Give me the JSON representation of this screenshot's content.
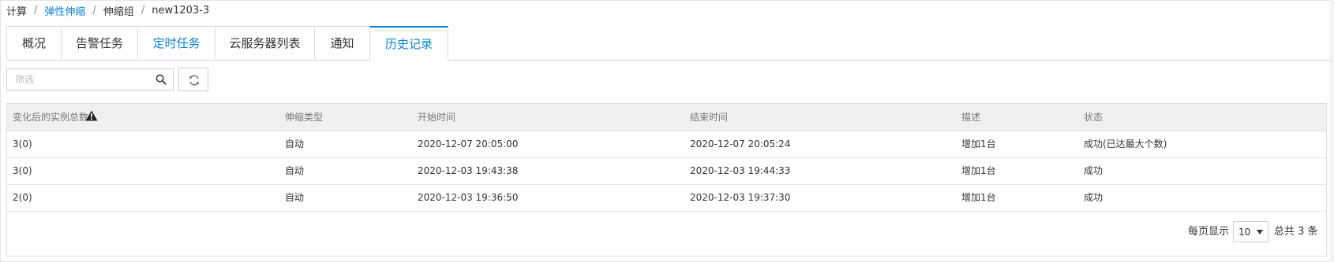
{
  "breadcrumb": [
    {
      "label": "计算"
    },
    {
      "label": "弹性伸缩"
    },
    {
      "label": "伸缩组"
    },
    {
      "label": "new1203-3"
    }
  ],
  "tabs": [
    {
      "label": "概况"
    },
    {
      "label": "告警任务"
    },
    {
      "label": "定时任务"
    },
    {
      "label": "云服务器列表"
    },
    {
      "label": "通知"
    },
    {
      "label": "历史记录"
    }
  ],
  "active_tab": "历史记录",
  "toolbar": {
    "search_placeholder": "筛选",
    "search_value": "",
    "search_icon": "search-icon",
    "refresh_icon": "refresh-icon"
  },
  "table": {
    "headers": [
      "变化后的实例总数",
      "伸缩类型",
      "开始时间",
      "结束时间",
      "描述",
      "状态"
    ],
    "header_icon": "warning-icon",
    "rows": [
      {
        "count": "3(0)",
        "type": "自动",
        "start": "2020-12-07 20:05:00",
        "end": "2020-12-07 20:05:24",
        "desc": "增加1台",
        "status": "成功(已达最大个数)"
      },
      {
        "count": "3(0)",
        "type": "自动",
        "start": "2020-12-03 19:43:38",
        "end": "2020-12-03 19:44:33",
        "desc": "增加1台",
        "status": "成功"
      },
      {
        "count": "2(0)",
        "type": "自动",
        "start": "2020-12-03 19:36:50",
        "end": "2020-12-03 19:37:30",
        "desc": "增加1台",
        "status": "成功"
      }
    ]
  },
  "pagination": {
    "per_page_label": "每页显示",
    "page_size": "10",
    "total_label": "总共 3 条"
  },
  "colors": {
    "accent": "#0a84c9",
    "header_bg": "#f0f0f0",
    "border": "#dedede"
  }
}
